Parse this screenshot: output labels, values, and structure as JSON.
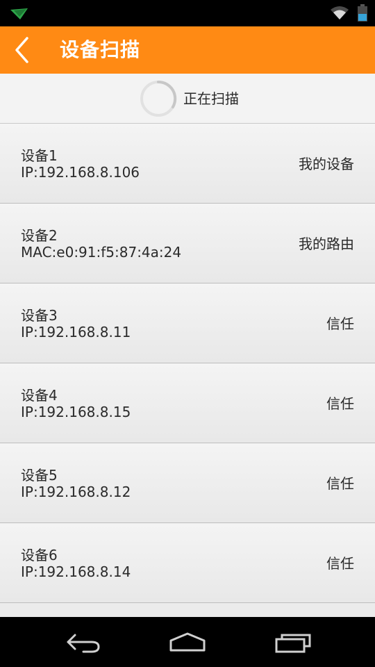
{
  "status_bar": {
    "icons": [
      "app-notification-icon",
      "wifi-icon",
      "battery-icon"
    ]
  },
  "header": {
    "title": "设备扫描",
    "back_icon": "chevron-left-icon",
    "background_color": "#ff8a14"
  },
  "scan": {
    "label": "正在扫描",
    "icon": "loading-spinner-icon"
  },
  "devices": [
    {
      "name": "设备1",
      "address": "IP:192.168.8.106",
      "status": "我的设备"
    },
    {
      "name": "设备2",
      "address": "MAC:e0:91:f5:87:4a:24",
      "status": "我的路由"
    },
    {
      "name": "设备3",
      "address": "IP:192.168.8.11",
      "status": "信任"
    },
    {
      "name": "设备4",
      "address": "IP:192.168.8.15",
      "status": "信任"
    },
    {
      "name": "设备5",
      "address": "IP:192.168.8.12",
      "status": "信任"
    },
    {
      "name": "设备6",
      "address": "IP:192.168.8.14",
      "status": "信任"
    }
  ],
  "navigation_bar": {
    "icons": [
      "back-arrow-icon",
      "home-icon",
      "recent-apps-icon"
    ]
  }
}
